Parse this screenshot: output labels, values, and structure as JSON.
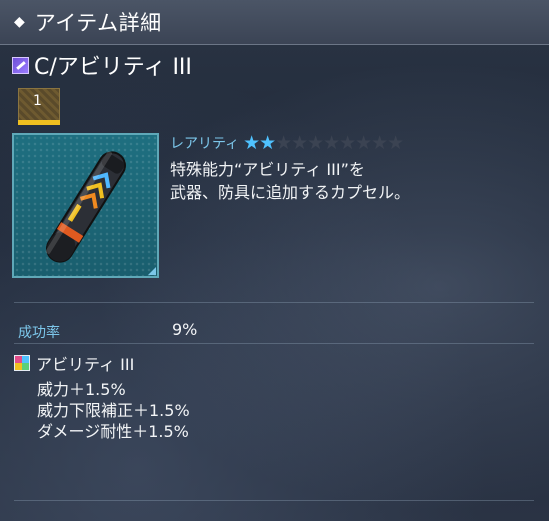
{
  "window": {
    "title": "アイテム詳細"
  },
  "item": {
    "name": "C/アビリティ III",
    "type_icon": "capsule-type-icon",
    "quantity": "1",
    "rarity_label": "レアリティ",
    "rarity": {
      "filled": 2,
      "total": 10
    },
    "description_lines": [
      "特殊能力“アビリティ III”を",
      "武器、防具に追加するカプセル。"
    ]
  },
  "success": {
    "label": "成功率",
    "value": "9%"
  },
  "ability": {
    "name": "アビリティ III",
    "effects": [
      "威力＋1.5%",
      "威力下限補正＋1.5%",
      "ダメージ耐性＋1.5%"
    ]
  },
  "colors": {
    "accent": "#7cc6ea",
    "star_on": "#4fc2ff",
    "star_off": "#3b4352",
    "quantity_bar": "#f0c020",
    "icon_bg": "#1e6f80"
  }
}
